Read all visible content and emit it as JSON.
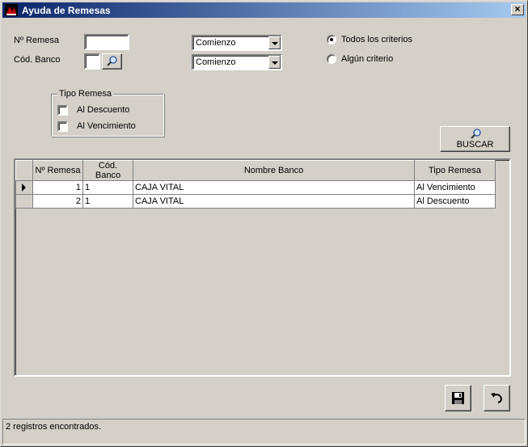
{
  "window": {
    "title": "Ayuda de Remesas",
    "close_glyph": "×"
  },
  "filters": {
    "remesa_label": "Nº Remesa",
    "banco_label": "Cód. Banco",
    "remesa_value": "",
    "banco_value": "",
    "match_mode_1": "Comienzo",
    "match_mode_2": "Comienzo",
    "criteria_all": "Todos los criterios",
    "criteria_any": "Algún criterio",
    "criteria_selected": "all"
  },
  "tipo_group": {
    "legend": "Tipo Remesa",
    "option_descuento": "Al Descuento",
    "option_vencimiento": "Al Vencimiento"
  },
  "buscar_button": {
    "label": "BUSCAR",
    "icon": "magnifier-icon"
  },
  "grid": {
    "columns": [
      "Nº Remesa",
      "Cód. Banco",
      "Nombre Banco",
      "Tipo Remesa"
    ],
    "rows": [
      {
        "remesa": "1",
        "banco": "1",
        "nombre": "CAJA VITAL",
        "tipo": "Al Vencimiento"
      },
      {
        "remesa": "2",
        "banco": "1",
        "nombre": "CAJA VITAL",
        "tipo": "Al Descuento"
      }
    ]
  },
  "actions": {
    "save_icon": "floppy-disk-icon",
    "undo_icon": "undo-arrow-icon"
  },
  "status": {
    "text": "2 registros encontrados."
  },
  "colors": {
    "titlebar_start": "#0a246a",
    "titlebar_end": "#a6caf0",
    "face": "#d4d0c8"
  }
}
